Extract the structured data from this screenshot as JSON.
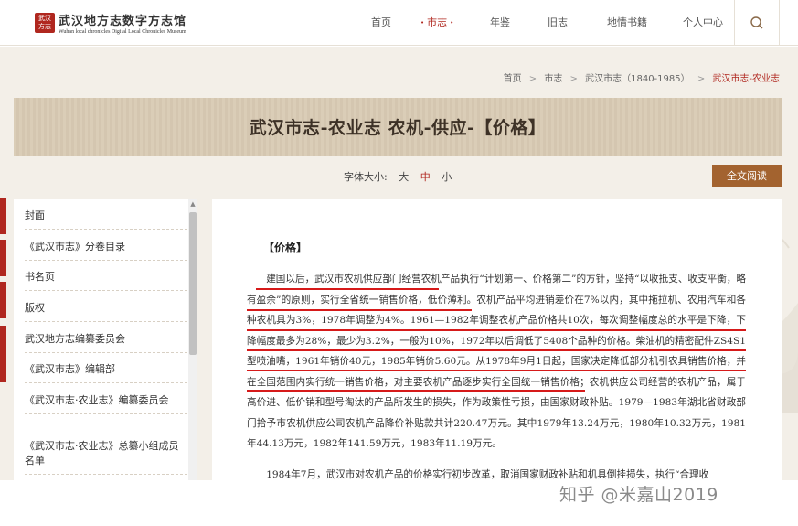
{
  "logo": {
    "seal_text": "武汉方志",
    "name_cn": "武汉地方志数字方志馆",
    "name_en": "Wuhan local chronicles Digital Local Chronicles Museum"
  },
  "nav": {
    "items": [
      "首页",
      "市志",
      "年鉴",
      "旧志",
      "地情书籍",
      "个人中心"
    ],
    "active_index": 1,
    "active_dot": "•"
  },
  "breadcrumb": {
    "items": [
      "首页",
      "市志",
      "武汉市志（1840-1985）"
    ],
    "current": "武汉市志-农业志",
    "separator": ">"
  },
  "page": {
    "title": "武汉市志-农业志 农机-供应-【价格】",
    "font_size_label": "字体大小:",
    "font_size_options": [
      "大",
      "中",
      "小"
    ],
    "font_size_selected": "中",
    "fulltext_button": "全文阅读"
  },
  "sidebar": {
    "items": [
      "封面",
      "《武汉市志》分卷目录",
      "书名页",
      "版权",
      "武汉地方志编纂委员会",
      "《武汉市志》编辑部",
      "《武汉市志·农业志》编纂委员会",
      "《武汉市志·农业志》总纂小组成员名单"
    ]
  },
  "content": {
    "section_heading": "【价格】",
    "paragraph_1": "建国以后，武汉市农机供应部门经营农机产品执行“计划第一、价格第二”的方针，坚持“以收抵支、收支平衡，略有盈余”的原则，实行全省统一销售价格，低价薄利。农机产品平均进销差价在7%以内，其中拖拉机、农用汽车和各种农机具为3%，1978年调整为4%。1961—1982年调整农机产品价格共10次，每次调整幅度总的水平是下降，下降幅度最多为28%，最少为3.2%，一般为10%，1972年以后调低了5408个品种的价格。柴油机的精密配件ZS4S1型喷油嘴，1961年销价40元，1985年销价5.60元。从1978年9月1日起，国家决定降低部分机引农具销售价格，并在全国范围内实行统一销售价格，对主要农机产品逐步实行全国统一销售价格；农机供应公司经营的农机产品，属于高价进、低价销和型号淘汰的产品所发生的损失，作为政策性亏损，由国家财政补贴。1979—1983年湖北省财政部门拾予市农机供应公司农机产品降价补贴款共计220.47万元。其中1979年13.24万元，1980年10.32万元，1981年44.13万元，1982年141.59万元，1983年11.19万元。",
    "paragraph_2": "1984年7月，武汉市对农机产品的价格实行初步改革，取消国家财政补贴和机具倒挂损失，执行“合理收"
  },
  "watermark": "知乎 @米嘉山2019",
  "colors": {
    "accent_red": "#b0271f",
    "banner": "#d8cab3",
    "background": "#f3efe8",
    "button_brown": "#a3632f",
    "underline_red": "#d61a1a"
  }
}
